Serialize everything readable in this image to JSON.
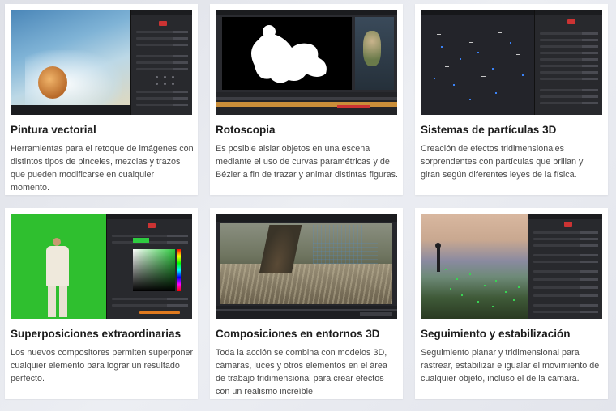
{
  "cards": [
    {
      "title": "Pintura vectorial",
      "description": "Herramientas para el retoque de imágenes con distintos tipos de pinceles, mezclas y trazos que pueden modificarse en cualquier momento."
    },
    {
      "title": "Rotoscopia",
      "description": "Es posible aislar objetos en una escena mediante el uso de curvas paramétricas y de Bézier a fin de trazar y animar distintas figuras."
    },
    {
      "title": "Sistemas de partículas 3D",
      "description": "Creación de efectos tridimensionales sorprendentes con partículas que brillan y giran según diferentes leyes de la física."
    },
    {
      "title": "Superposiciones extraordinarias",
      "description": "Los nuevos compositores permiten superponer cualquier elemento para lograr un resultado perfecto."
    },
    {
      "title": "Composiciones en entornos 3D",
      "description": "Toda la acción se combina con modelos 3D, cámaras, luces y otros elementos en el área de trabajo tridimensional para crear efectos con un realismo increíble."
    },
    {
      "title": "Seguimiento y estabilización",
      "description": "Seguimiento planar y tridimensional para rastrear, estabilizar e igualar el movimiento de cualquier objeto, incluso el de la cámara."
    }
  ]
}
